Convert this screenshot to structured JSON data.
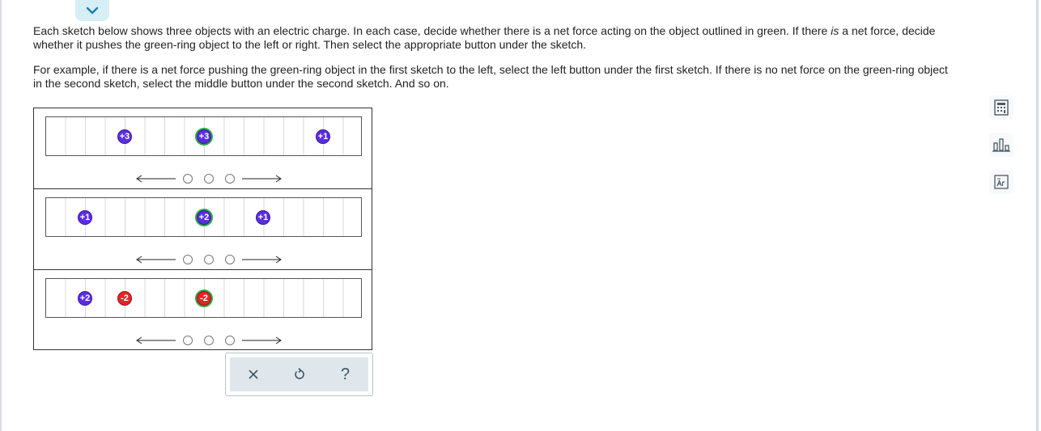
{
  "instructions": {
    "p1_a": "Each sketch below shows three objects with an electric charge. In each case, decide whether there is a net force acting on the object outlined in green. If there ",
    "p1_em": "is",
    "p1_b": " a net force, decide whether it pushes the green-ring object to the left or right. Then select the appropriate button under the sketch.",
    "p2": "For example, if there is a net force pushing the green-ring object in the first sketch to the left, select the left button under the first sketch. If there is no net force on the green-ring object in the second sketch, select the middle button under the second sketch. And so on."
  },
  "sketches": [
    {
      "charges": [
        {
          "label": "+3"
        },
        {
          "label": "+3"
        },
        {
          "label": "+1"
        }
      ]
    },
    {
      "charges": [
        {
          "label": "+1"
        },
        {
          "label": "+2"
        },
        {
          "label": "+1"
        }
      ]
    },
    {
      "charges": [
        {
          "label": "+2"
        },
        {
          "label": "-2"
        },
        {
          "label": "-2"
        }
      ]
    }
  ],
  "toolbar": {
    "clear_icon": "x-icon",
    "undo_icon": "undo-icon",
    "help_label": "?"
  },
  "side_tools": [
    "calculator-icon",
    "chart-icon",
    "periodic-table-icon"
  ],
  "colors": {
    "positive": "#5a2de0",
    "negative": "#e5232a",
    "target_ring": "#2fae46",
    "accent": "#1a7fb0"
  }
}
